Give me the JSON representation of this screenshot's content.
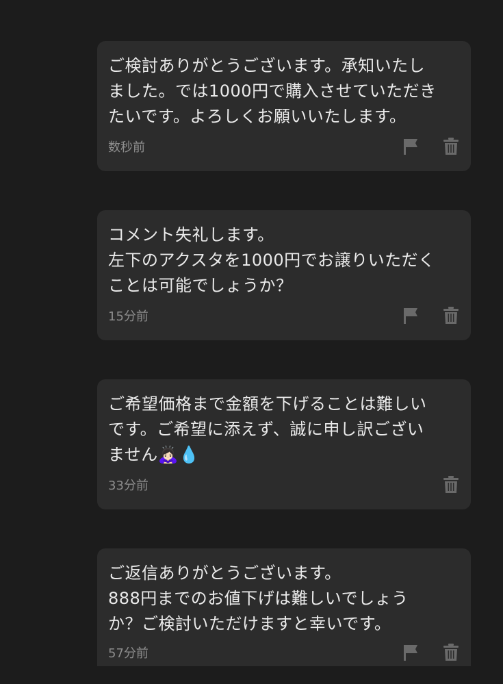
{
  "messages": [
    {
      "text": "ご検討ありがとうございます。承知いたし\nました。では1000円で購入させていただき\nたいです。よろしくお願いいたします。",
      "time": "数秒前",
      "has_flag": true
    },
    {
      "text": "コメント失礼します。\n左下のアクスタを1000円でお譲りいただく\nことは可能でしょうか？",
      "time": "15分前",
      "has_flag": true
    },
    {
      "text_line1": "ご希望価格まで金額を下げることは難しい",
      "text_line2": "です。ご希望に添えず、誠に申し訳ござい",
      "text_line3": "ません",
      "emoji_bow": "🙇🏻‍♀️",
      "emoji_drop": "💧",
      "time": "33分前",
      "has_flag": false
    },
    {
      "text": "ご返信ありがとうございます。\n888円までのお値下げは難しいでしょう\nか？ご検討いただけますと幸いです。",
      "time": "57分前",
      "has_flag": true
    }
  ],
  "icons": {
    "flag": "flag-icon",
    "trash": "trash-icon"
  },
  "colors": {
    "background": "#1c1c1c",
    "bubble": "#2c2c2c",
    "text": "#eaeaea",
    "meta": "#8e8e8e",
    "icon": "#6a6a6a"
  }
}
